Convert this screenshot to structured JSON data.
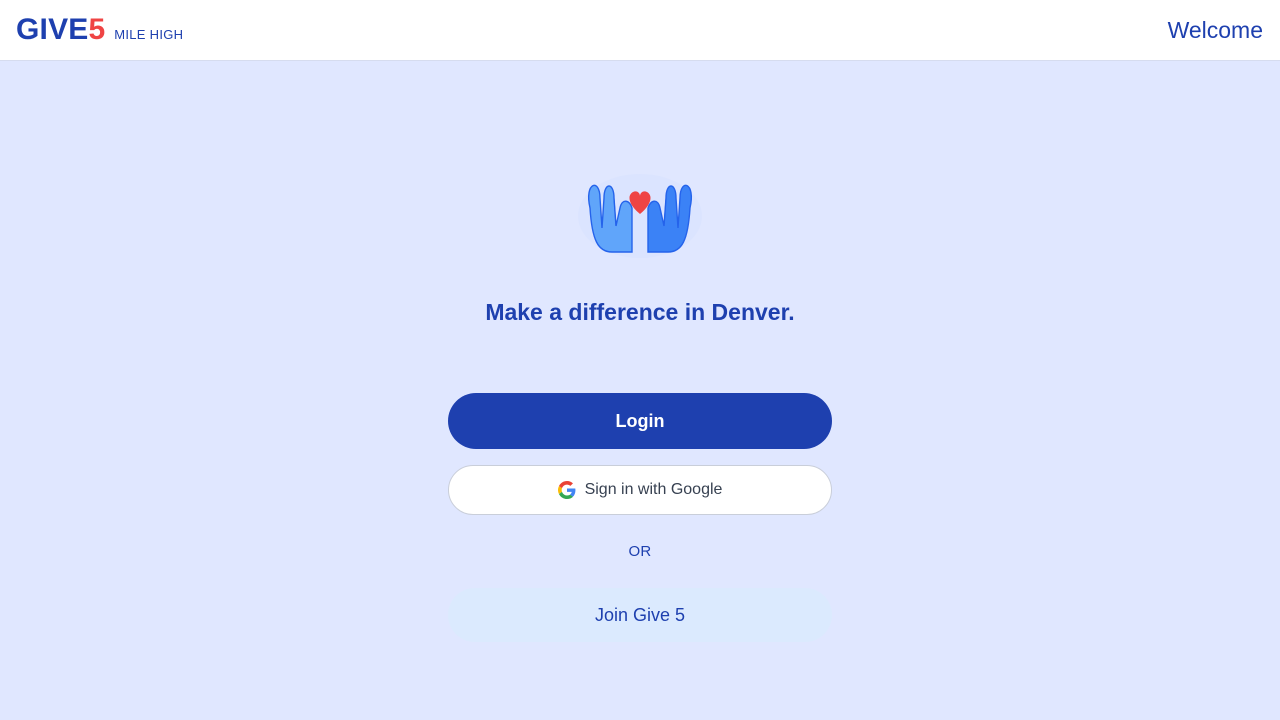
{
  "header": {
    "brand_word": "GIVE",
    "brand_number": "5",
    "brand_subtitle": "MILE HIGH",
    "welcome": "Welcome"
  },
  "hero": {
    "icon": "hands-holding-heart-icon",
    "tagline": "Make a difference in Denver."
  },
  "actions": {
    "login_label": "Login",
    "google_label": "Sign in with Google",
    "google_icon": "google-g-icon",
    "or_label": "OR",
    "join_label": "Join Give 5"
  },
  "colors": {
    "primary": "#1e40af",
    "accent": "#ef4444",
    "background": "#e0e7ff",
    "join_bg": "#dbeafe"
  }
}
